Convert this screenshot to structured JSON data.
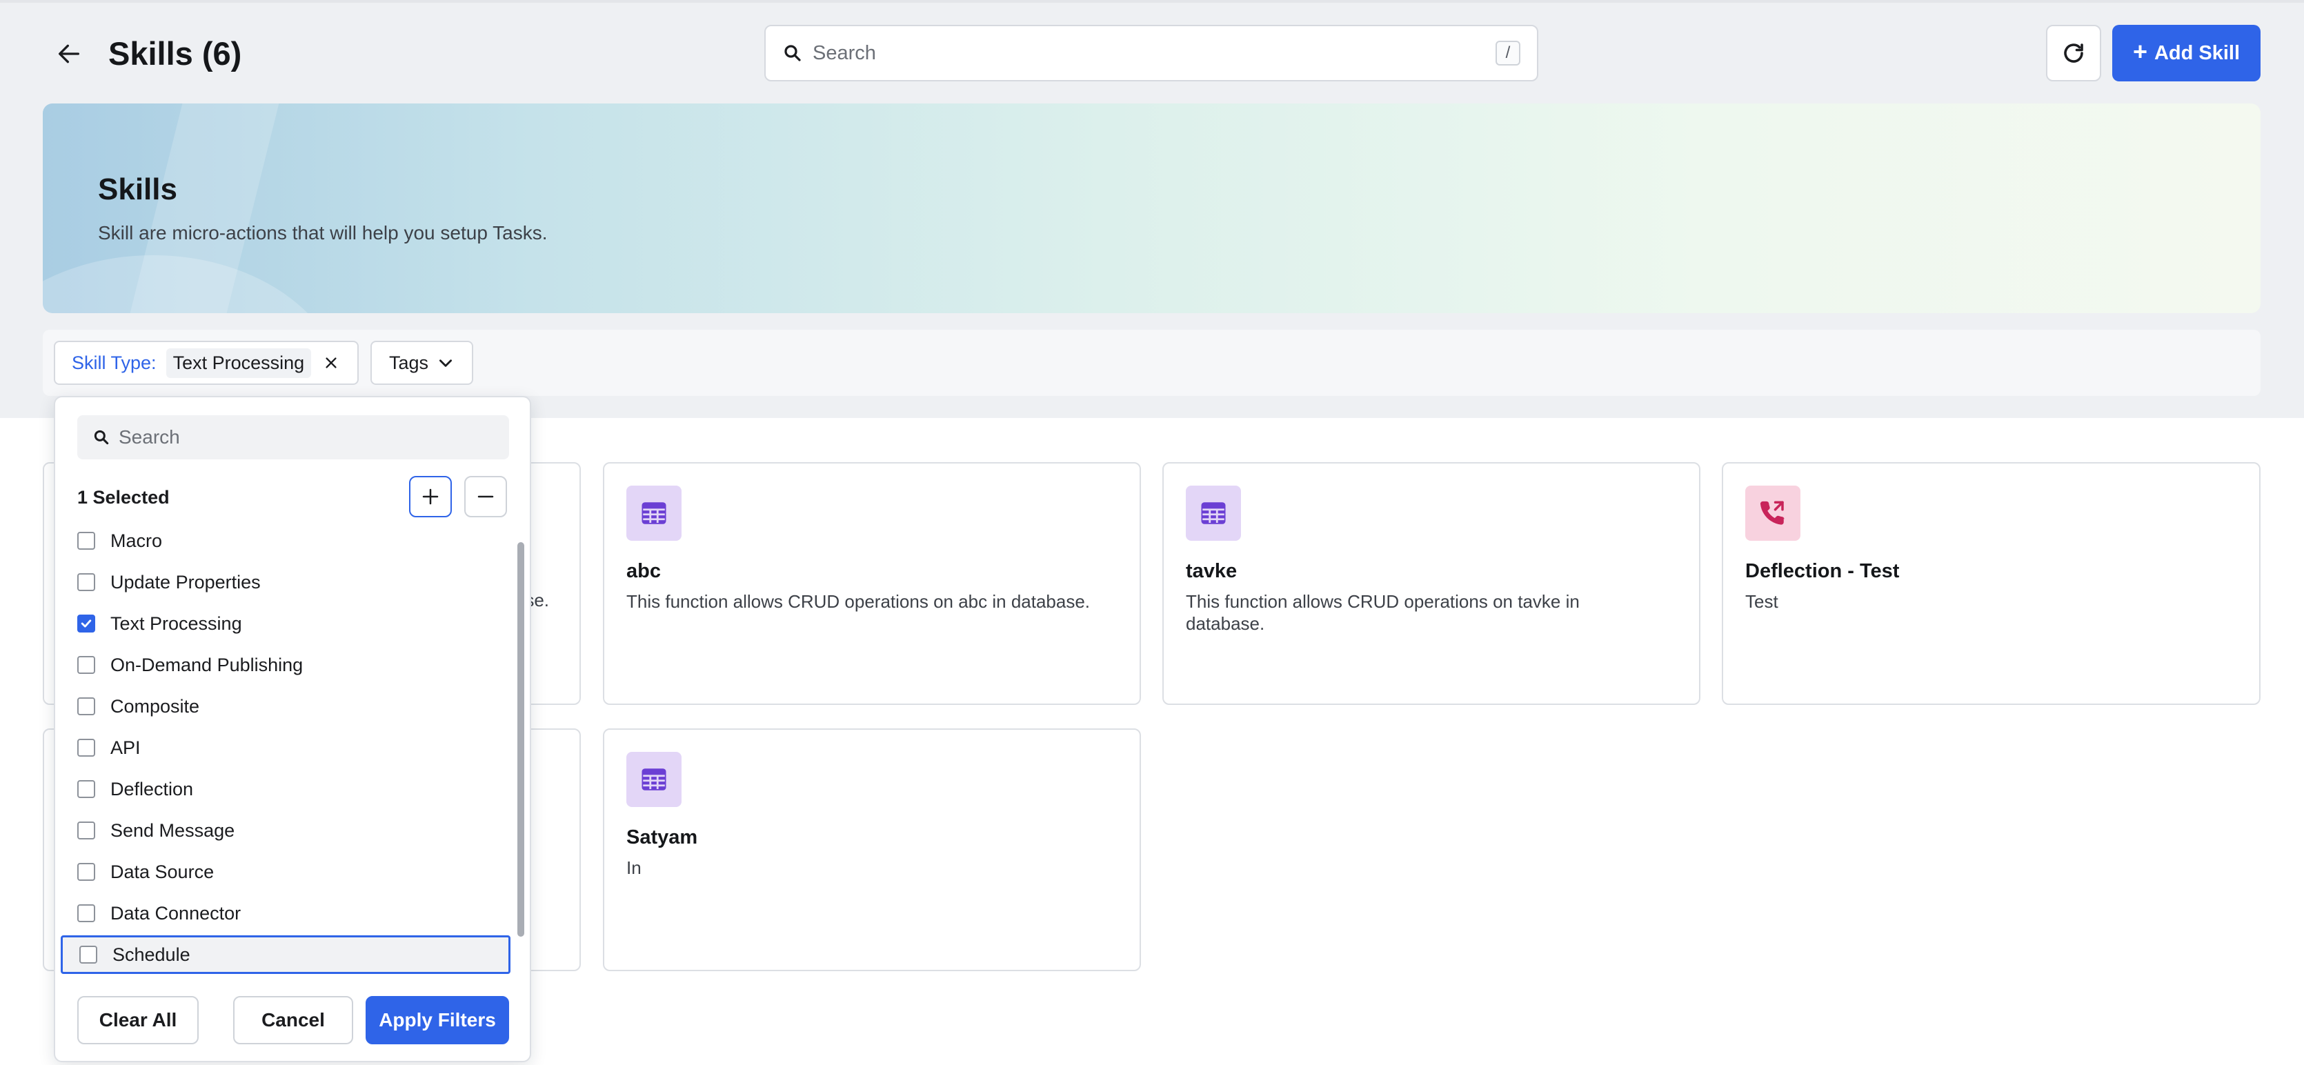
{
  "header": {
    "title": "Skills (6)",
    "search_placeholder": "Search",
    "search_shortcut": "/",
    "add_button_label": "Add Skill"
  },
  "banner": {
    "title": "Skills",
    "subtitle": "Skill are micro-actions that will help you setup Tasks."
  },
  "filters": {
    "skill_type_label": "Skill Type:",
    "skill_type_value": "Text Processing",
    "tags_label": "Tags"
  },
  "cards": [
    {
      "title": "abc",
      "description": "This function allows CRUD operations on abc in database.",
      "icon": "table-grid-icon"
    },
    {
      "title": "tavke",
      "description": "This function allows CRUD operations on tavke in database.",
      "icon": "table-grid-icon"
    },
    {
      "title": "Deflection - Test",
      "description": "Test",
      "icon": "phone-transfer-icon"
    },
    {
      "title": "Satyam",
      "description": "In",
      "icon": "table-grid-icon"
    }
  ],
  "partial_card_fragment": "se.",
  "dropdown": {
    "search_placeholder": "Search",
    "selected_count": "1 Selected",
    "items": [
      {
        "label": "Macro",
        "checked": false
      },
      {
        "label": "Update Properties",
        "checked": false
      },
      {
        "label": "Text Processing",
        "checked": true
      },
      {
        "label": "On-Demand Publishing",
        "checked": false
      },
      {
        "label": "Composite",
        "checked": false
      },
      {
        "label": "API",
        "checked": false
      },
      {
        "label": "Deflection",
        "checked": false
      },
      {
        "label": "Send Message",
        "checked": false
      },
      {
        "label": "Data Source",
        "checked": false
      },
      {
        "label": "Data Connector",
        "checked": false
      },
      {
        "label": "Schedule",
        "checked": false
      }
    ],
    "clear_label": "Clear All",
    "cancel_label": "Cancel",
    "apply_label": "Apply Filters"
  },
  "colors": {
    "accent": "#2f64e8",
    "grid_icon_bg": "#e3d6f7",
    "grid_icon_fg": "#6b3fd4",
    "phone_icon_bg": "#f8d2df",
    "phone_icon_fg": "#c8245a"
  }
}
